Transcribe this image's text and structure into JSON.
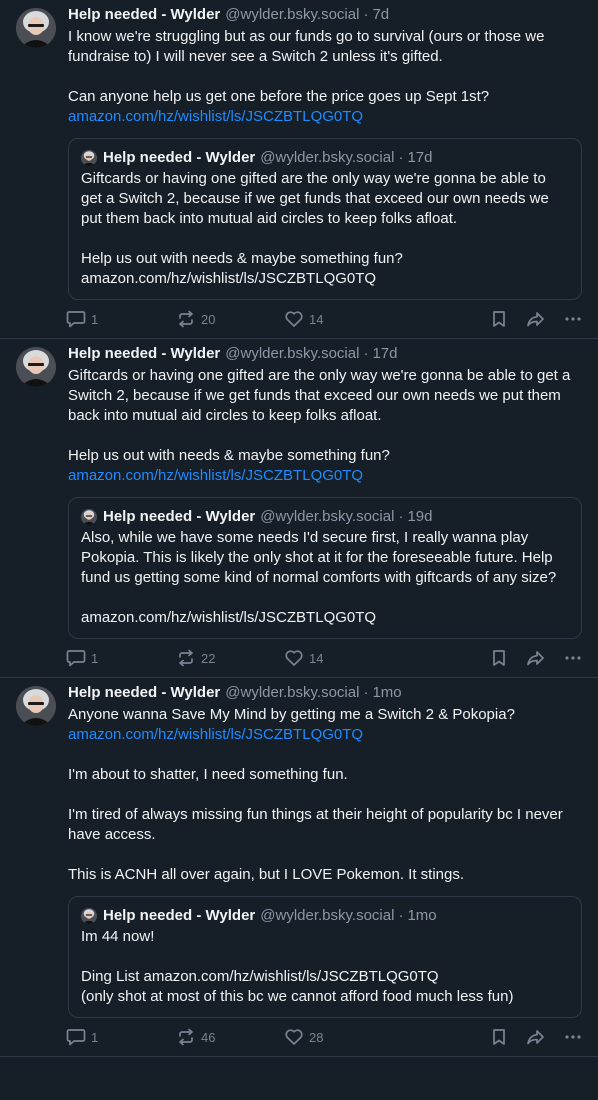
{
  "posts": [
    {
      "author": {
        "name": "Help needed - Wylder",
        "handle": "@wylder.bsky.social",
        "separator": "·",
        "time": "7d"
      },
      "text": [
        "I know we're struggling but as our funds go to survival (ours or those we fundraise to) I will never see a Switch 2 unless it's gifted.",
        "Can anyone help us get one before the price goes up Sept 1st?"
      ],
      "link": "amazon.com/hz/wishlist/ls/JSCZBTLQG0TQ",
      "quote": {
        "author": {
          "name": "Help needed - Wylder",
          "handle": "@wylder.bsky.social",
          "separator": "·",
          "time": "17d"
        },
        "text": [
          "Giftcards or having one gifted are the only way we're gonna be able to get a Switch 2, because if we get funds that exceed our own needs we put them back into mutual aid circles to keep folks afloat.",
          "Help us out with needs & maybe something fun?\namazon.com/hz/wishlist/ls/JSCZBTLQG0TQ"
        ]
      },
      "counts": {
        "replies": "1",
        "reposts": "20",
        "likes": "14"
      }
    },
    {
      "author": {
        "name": "Help needed - Wylder",
        "handle": "@wylder.bsky.social",
        "separator": "·",
        "time": "17d"
      },
      "text": [
        "Giftcards or having one gifted are the only way we're gonna be able to get a Switch 2, because if we get funds that exceed our own needs we put them back into mutual aid circles to keep folks afloat.",
        "Help us out with needs & maybe something fun?"
      ],
      "link": "amazon.com/hz/wishlist/ls/JSCZBTLQG0TQ",
      "quote": {
        "author": {
          "name": "Help needed - Wylder",
          "handle": "@wylder.bsky.social",
          "separator": "·",
          "time": "19d"
        },
        "text": [
          "Also, while we have some needs I'd secure first, I really wanna play Pokopia. This is likely the only shot at it for the foreseeable future. Help fund us getting some kind of normal comforts with giftcards of any size?",
          "amazon.com/hz/wishlist/ls/JSCZBTLQG0TQ"
        ]
      },
      "counts": {
        "replies": "1",
        "reposts": "22",
        "likes": "14"
      }
    },
    {
      "author": {
        "name": "Help needed - Wylder",
        "handle": "@wylder.bsky.social",
        "separator": "·",
        "time": "1mo"
      },
      "text_before_link": "Anyone wanna Save My Mind by getting me a Switch 2 & Pokopia?",
      "link": "amazon.com/hz/wishlist/ls/JSCZBTLQG0TQ",
      "text": [
        "I'm about to shatter, I need something fun.",
        "I'm tired of always missing fun things at their height of popularity bc I never have access.",
        "This is ACNH all over again, but I LOVE Pokemon. It stings."
      ],
      "quote": {
        "author": {
          "name": "Help needed - Wylder",
          "handle": "@wylder.bsky.social",
          "separator": "·",
          "time": "1mo"
        },
        "text": [
          "Im 44 now!",
          "Ding List amazon.com/hz/wishlist/ls/JSCZBTLQG0TQ\n(only shot at most of this bc we cannot afford food much less fun)"
        ]
      },
      "counts": {
        "replies": "1",
        "reposts": "46",
        "likes": "28"
      }
    }
  ],
  "icons": {
    "reply": "speech-bubble-icon",
    "repost": "repost-arrows-icon",
    "like": "heart-icon",
    "bookmark": "bookmark-icon",
    "share": "share-arrow-icon",
    "more": "ellipsis-icon"
  },
  "colors": {
    "background": "#161e27",
    "link": "#208bfe",
    "muted": "#8b98a8",
    "border": "#2e3a47"
  }
}
